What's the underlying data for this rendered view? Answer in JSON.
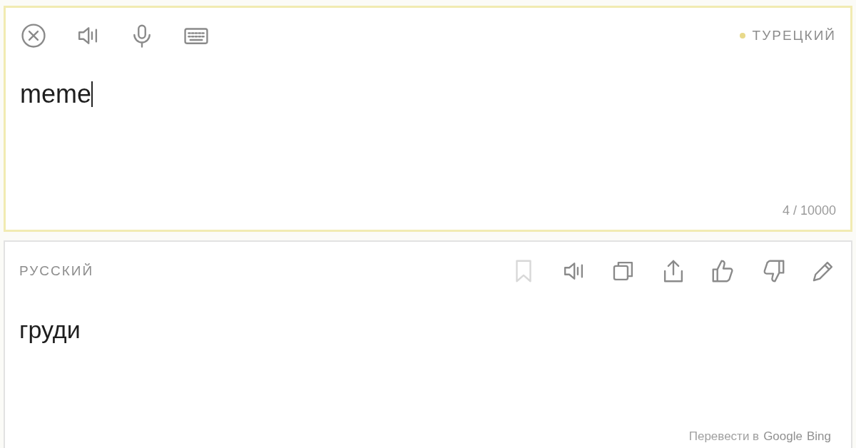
{
  "source": {
    "tools": [
      {
        "kind": "clear"
      },
      {
        "kind": "speak"
      },
      {
        "kind": "mic"
      },
      {
        "kind": "keyboard"
      }
    ],
    "language": {
      "label": "ТУРЕЦКИЙ",
      "color": "#e8d98a"
    },
    "text": "meme",
    "counter": "4 / 10000"
  },
  "target": {
    "language": "РУССКИЙ",
    "actions": [
      {
        "kind": "bookmark",
        "disabled": true
      },
      {
        "kind": "speak",
        "disabled": false
      },
      {
        "kind": "copy",
        "disabled": false
      },
      {
        "kind": "share",
        "disabled": false
      },
      {
        "kind": "like",
        "disabled": false
      },
      {
        "kind": "dislike",
        "disabled": false
      },
      {
        "kind": "edit",
        "disabled": false
      }
    ],
    "text": "груди",
    "footer": {
      "prefix": "Перевести в",
      "links": [
        "Google",
        "Bing"
      ]
    }
  }
}
